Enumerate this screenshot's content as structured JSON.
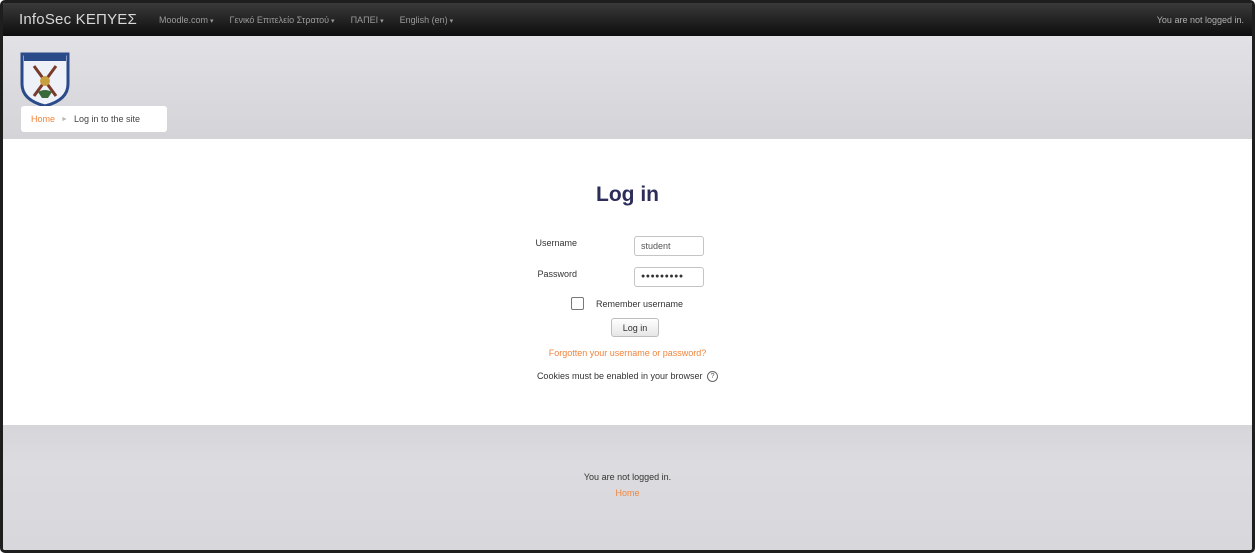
{
  "topbar": {
    "brand": "InfoSec ΚΕΠΥΕΣ",
    "menu": [
      {
        "label": "Moodle.com"
      },
      {
        "label": "Γενικό Επιτελείο Στρατού"
      },
      {
        "label": "ΠΑΠΕΙ"
      },
      {
        "label": "English (en)"
      }
    ],
    "status": "You are not logged in."
  },
  "breadcrumb": {
    "home": "Home",
    "separator": "►",
    "current": "Log in to the site"
  },
  "login": {
    "title": "Log in",
    "username_label": "Username",
    "username_value": "student",
    "password_label": "Password",
    "password_value": "●●●●●●●●●",
    "remember_label": "Remember username",
    "button_label": "Log in",
    "forgot_link": "Forgotten your username or password?",
    "cookies_text": "Cookies must be enabled in your browser",
    "help_icon": "?"
  },
  "footer": {
    "status": "You are not logged in.",
    "home_link": "Home"
  },
  "colors": {
    "accent": "#f0843c",
    "title": "#2d2d5a",
    "navbar": "#1a1a1a"
  }
}
